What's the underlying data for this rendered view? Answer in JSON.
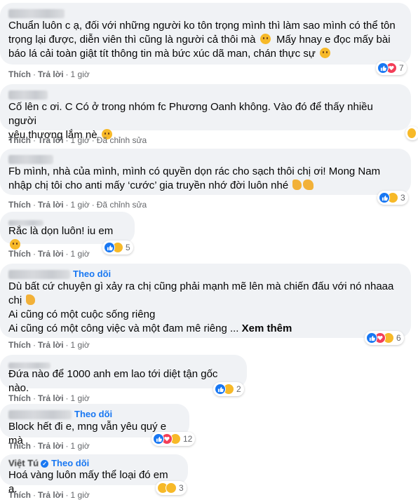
{
  "labels": {
    "like": "Thích",
    "reply": "Trả lời",
    "follow": "Theo dõi",
    "see_more": "Xem thêm",
    "edited": "Đã chỉnh sửa"
  },
  "comments": [
    {
      "name": "",
      "lines": [
        "Chuẩn luôn c ạ, đối với những người ko tôn trọng mình thì làm sao mình có thể tôn",
        "trọng lại được, diễn viên thì cũng là người cả thôi mà",
        "báo lá cải toàn giật tít thông tin mà bức xúc dã man, chán thực sự"
      ],
      "line2_tail": "Mấy hnay e đọc mấy bài",
      "time": "1 giờ",
      "reactions": [
        "like",
        "love",
        "care"
      ],
      "reaction_count": "7"
    },
    {
      "name": "",
      "lines": [
        "Cố lên c ơi. C Có ở trong nhóm fc Phương Oanh không. Vào đó để thấy nhiều người",
        "yêu thương lắm nè"
      ],
      "time": "1 giờ",
      "edited": true,
      "reactions": [
        "care"
      ],
      "reaction_count": ""
    },
    {
      "name": "",
      "lines": [
        "Fb mình, nhà của mình, mình có quyền dọn rác cho sạch thôi chị ơi! Mong Nam",
        "nhập chị tôi cho anti mấy ‘cước’ gia truyền nhớ đời luôn nhé"
      ],
      "time": "1 giờ",
      "edited": true,
      "reactions": [
        "like",
        "care"
      ],
      "reaction_count": "3"
    },
    {
      "name": "",
      "lines": [
        "Rắc là dọn luôn! iu em"
      ],
      "time": "1 giờ",
      "reactions": [
        "like",
        "care"
      ],
      "reaction_count": "5"
    },
    {
      "name": "",
      "follow": true,
      "lines": [
        "Dù bất cứ chuyện gì xảy ra chị cũng phải mạnh mẽ lên mà chiến đấu với nó nhaaa",
        "chị",
        "Ai cũng có một cuộc sống riêng",
        "Ai cũng có một công việc và một đam mê riêng ..."
      ],
      "time": "1 giờ",
      "reactions": [
        "like",
        "love",
        "haha"
      ],
      "reaction_count": "6"
    },
    {
      "name": "",
      "lines": [
        "Đứa nào để 1000 anh em lao tới diệt tận gốc nào."
      ],
      "time": "1 giờ",
      "reactions": [
        "like",
        "care"
      ],
      "reaction_count": "2"
    },
    {
      "name": "",
      "follow": true,
      "lines": [
        "Block hết đi e, mng vẫn yêu quý e mà"
      ],
      "time": "1 giờ",
      "reactions": [
        "like",
        "love",
        "care"
      ],
      "reaction_count": "12"
    },
    {
      "name": "Việt Tú",
      "follow": true,
      "lines": [
        "Hoá vàng luôn mấy thể loại đó em ạ."
      ],
      "time": "1 giờ",
      "reactions": [
        "care",
        "haha"
      ],
      "reaction_count": "3"
    }
  ]
}
